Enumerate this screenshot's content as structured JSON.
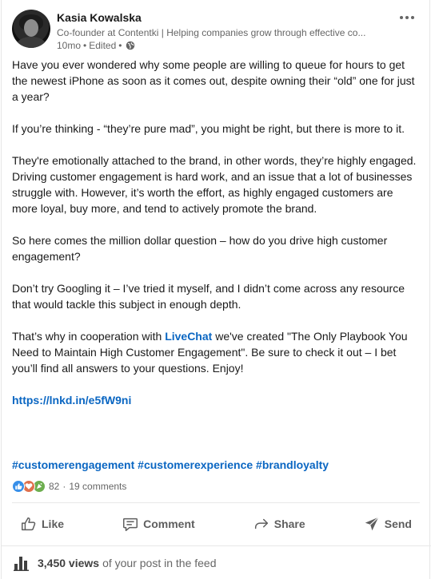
{
  "author": {
    "name": "Kasia Kowalska",
    "headline": "Co-founder at Contentki | Helping companies grow through effective co...",
    "time": "10mo",
    "edited": "Edited",
    "separator": "•"
  },
  "post": {
    "paragraphs": [
      "Have you ever wondered why some people are willing to queue for hours to get the newest iPhone as soon as it comes out, despite owning their “old” one for just a year?",
      "If you’re thinking - “they’re pure mad”, you might be right, but there is more to it.",
      "They're emotionally attached to the brand, in other words, they’re highly engaged. Driving customer engagement is hard work, and an issue that a lot of businesses struggle with. However, it’s worth the effort, as highly engaged customers are more loyal, buy more, and tend to actively promote the brand.",
      "So here comes the million dollar question – how do you drive high customer engagement?",
      "Don’t try Googling it – I’ve tried it myself, and I didn’t come across any resource that would tackle this subject in enough depth."
    ],
    "cta_before": "That’s why in cooperation with ",
    "mention": "LiveChat",
    "cta_after": " we've created \"The Only Playbook You Need to Maintain High Customer Engagement\". Be sure to check it out – I bet you’ll find all answers to your questions. Enjoy!",
    "link": "https://lnkd.in/e5fW9ni",
    "hashtags": [
      "#customerengagement",
      "#customerexperience",
      "#brandloyalty"
    ]
  },
  "social": {
    "reaction_count": "82",
    "separator": "·",
    "comments": "19 comments"
  },
  "actions": {
    "like": "Like",
    "comment": "Comment",
    "share": "Share",
    "send": "Send"
  },
  "footer": {
    "views": "3,450 views",
    "suffix": "of your post in the feed"
  },
  "colors": {
    "link": "#0a66c2",
    "like_reaction": "#378fe9",
    "love_reaction": "#df704d",
    "celebrate_reaction": "#6dae4f"
  }
}
